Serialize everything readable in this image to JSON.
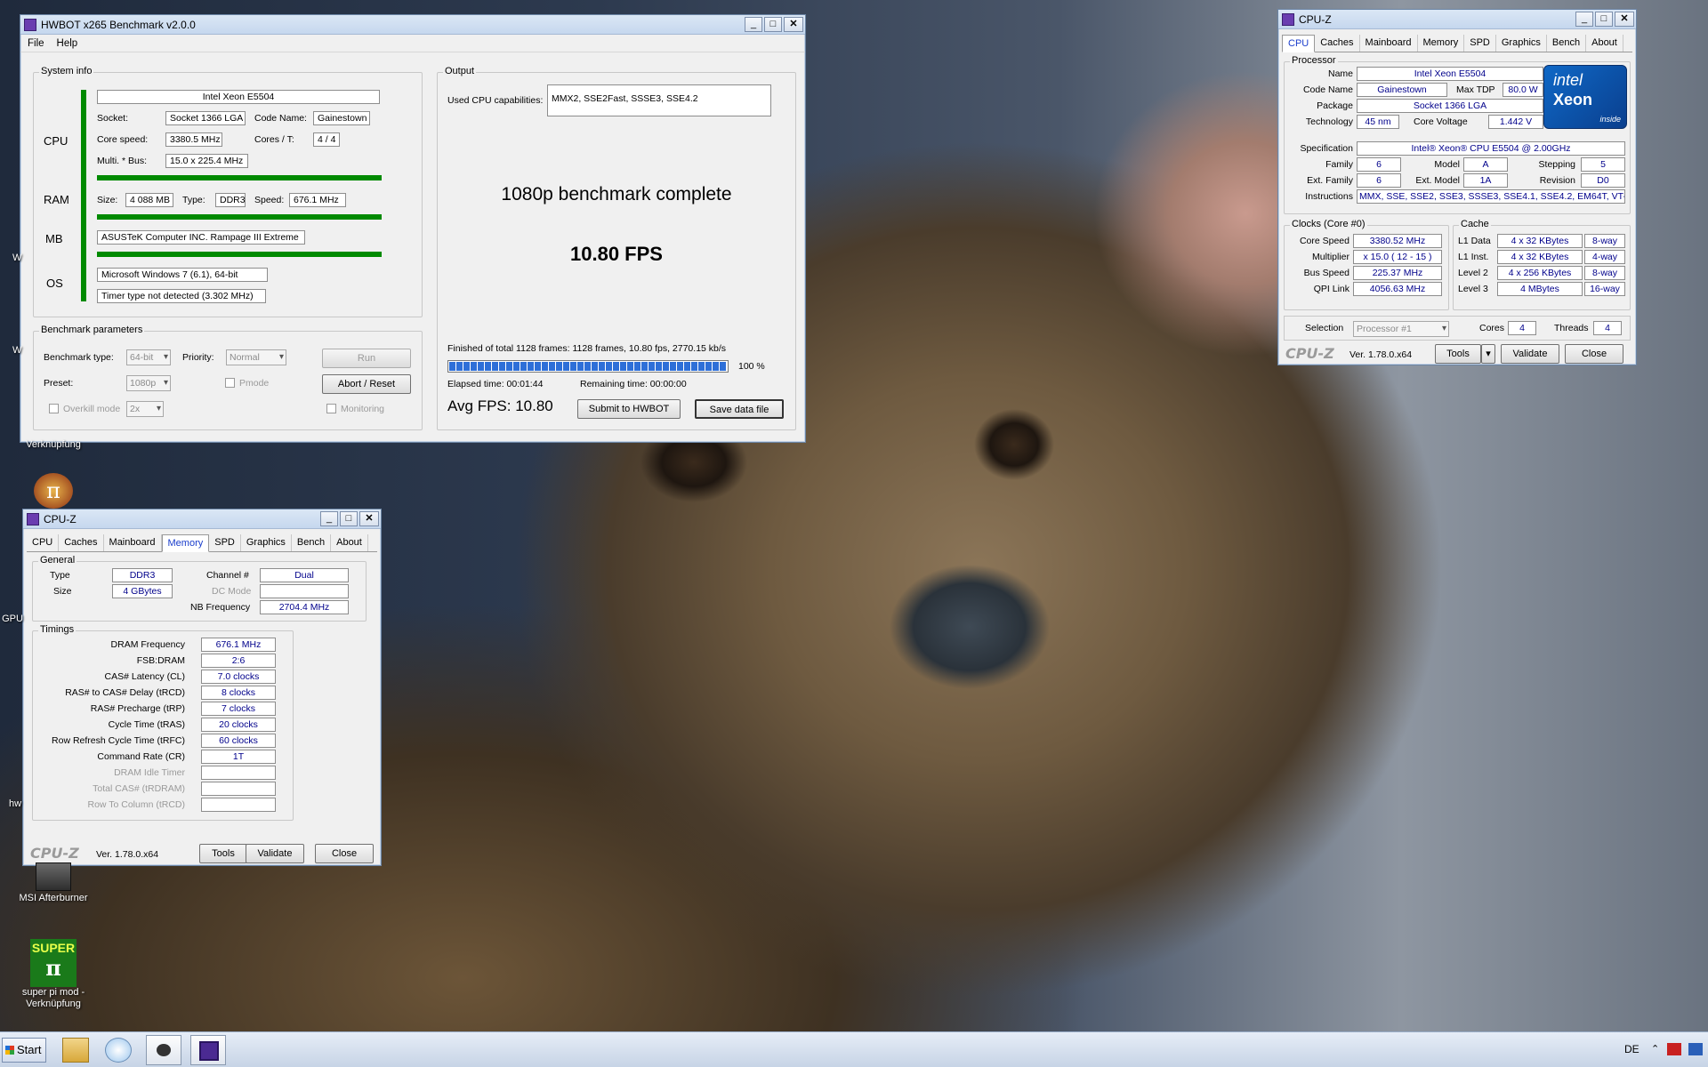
{
  "hwbot": {
    "title": "HWBOT x265 Benchmark v2.0.0",
    "menu": [
      "File",
      "Help"
    ],
    "sysinfo": {
      "group_title": "System info",
      "cpu_label": "CPU",
      "ram_label": "RAM",
      "mb_label": "MB",
      "os_label": "OS",
      "cpu_name": "Intel Xeon E5504",
      "socket_label": "Socket:",
      "socket": "Socket 1366 LGA",
      "codename_label": "Code Name:",
      "codename": "Gainestown",
      "corespeed_label": "Core speed:",
      "corespeed": "3380.5 MHz",
      "cores_label": "Cores / T:",
      "cores": "4 / 4",
      "multi_label": "Multi. * Bus:",
      "multi": "15.0 x 225.4 MHz",
      "size_label": "Size:",
      "size": "4 088 MB",
      "type_label": "Type:",
      "type": "DDR3",
      "speed_label": "Speed:",
      "speed": "676.1 MHz",
      "mb": "ASUSTeK Computer INC. Rampage III Extreme",
      "os": "Microsoft Windows 7 (6.1), 64-bit",
      "timer": "Timer type not detected (3.302 MHz)"
    },
    "params": {
      "group_title": "Benchmark parameters",
      "bench_type_label": "Benchmark type:",
      "bench_type": "64-bit",
      "priority_label": "Priority:",
      "priority": "Normal",
      "run_label": "Run",
      "preset_label": "Preset:",
      "preset": "1080p",
      "pmode_label": "Pmode",
      "abort_label": "Abort / Reset",
      "overkill_label": "Overkill mode",
      "overkill": "2x",
      "monitoring_label": "Monitoring"
    },
    "output": {
      "group_title": "Output",
      "caps_label": "Used CPU capabilities:",
      "caps": "MMX2, SSE2Fast, SSSE3, SSE4.2",
      "status": "1080p benchmark complete",
      "fps": "10.80 FPS",
      "finished": "Finished of total 1128 frames: 1128 frames, 10.80 fps,  2770.15 kb/s",
      "progress_pct": 100,
      "progress_text": "100 %",
      "elapsed": "Elapsed time: 00:01:44",
      "remaining": "Remaining time: 00:00:00",
      "avg": "Avg FPS: 10.80",
      "submit_label": "Submit to HWBOT",
      "save_label": "Save data file"
    }
  },
  "cpuz_cpu": {
    "title": "CPU-Z",
    "tabs": [
      "CPU",
      "Caches",
      "Mainboard",
      "Memory",
      "SPD",
      "Graphics",
      "Bench",
      "About"
    ],
    "processor_title": "Processor",
    "name_label": "Name",
    "name": "Intel Xeon E5504",
    "codename_label": "Code Name",
    "codename": "Gainestown",
    "maxtdp_label": "Max TDP",
    "maxtdp": "80.0 W",
    "package_label": "Package",
    "package": "Socket 1366 LGA",
    "tech_label": "Technology",
    "tech": "45 nm",
    "voltage_label": "Core Voltage",
    "voltage": "1.442 V",
    "spec_label": "Specification",
    "spec": "Intel® Xeon® CPU           E5504  @ 2.00GHz",
    "family_label": "Family",
    "family": "6",
    "model_label": "Model",
    "model": "A",
    "stepping_label": "Stepping",
    "stepping": "5",
    "extfamily_label": "Ext. Family",
    "extfamily": "6",
    "extmodel_label": "Ext. Model",
    "extmodel": "1A",
    "revision_label": "Revision",
    "revision": "D0",
    "instr_label": "Instructions",
    "instr": "MMX, SSE, SSE2, SSE3, SSSE3, SSE4.1, SSE4.2, EM64T, VT-x",
    "logo_brand": "intel",
    "logo_product": "Xeon",
    "logo_tag": "inside",
    "clocks_title": "Clocks (Core #0)",
    "corespeed_label": "Core Speed",
    "corespeed": "3380.52 MHz",
    "multiplier_label": "Multiplier",
    "multiplier": "x 15.0 ( 12 - 15 )",
    "busspeed_label": "Bus Speed",
    "busspeed": "225.37 MHz",
    "qpi_label": "QPI Link",
    "qpi": "4056.63 MHz",
    "cache_title": "Cache",
    "l1d_label": "L1 Data",
    "l1d": "4 x 32 KBytes",
    "l1d_way": "8-way",
    "l1i_label": "L1 Inst.",
    "l1i": "4 x 32 KBytes",
    "l1i_way": "4-way",
    "l2_label": "Level 2",
    "l2": "4 x 256 KBytes",
    "l2_way": "8-way",
    "l3_label": "Level 3",
    "l3": "4 MBytes",
    "l3_way": "16-way",
    "selection_label": "Selection",
    "selection": "Processor #1",
    "cores_label": "Cores",
    "cores": "4",
    "threads_label": "Threads",
    "threads": "4",
    "brand": "CPU-Z",
    "version": "Ver. 1.78.0.x64",
    "tools_label": "Tools",
    "validate_label": "Validate",
    "close_label": "Close"
  },
  "cpuz_mem": {
    "title": "CPU-Z",
    "tabs": [
      "CPU",
      "Caches",
      "Mainboard",
      "Memory",
      "SPD",
      "Graphics",
      "Bench",
      "About"
    ],
    "general_title": "General",
    "type_label": "Type",
    "type": "DDR3",
    "size_label": "Size",
    "size": "4 GBytes",
    "channel_label": "Channel #",
    "channel": "Dual",
    "dcmode_label": "DC Mode",
    "nbfreq_label": "NB Frequency",
    "nbfreq": "2704.4 MHz",
    "timings_title": "Timings",
    "rows": [
      {
        "label": "DRAM Frequency",
        "value": "676.1 MHz"
      },
      {
        "label": "FSB:DRAM",
        "value": "2:6"
      },
      {
        "label": "CAS# Latency (CL)",
        "value": "7.0 clocks"
      },
      {
        "label": "RAS# to CAS# Delay (tRCD)",
        "value": "8 clocks"
      },
      {
        "label": "RAS# Precharge (tRP)",
        "value": "7 clocks"
      },
      {
        "label": "Cycle Time (tRAS)",
        "value": "20 clocks"
      },
      {
        "label": "Row Refresh Cycle Time (tRFC)",
        "value": "60 clocks"
      },
      {
        "label": "Command Rate (CR)",
        "value": "1T"
      }
    ],
    "dis_rows": [
      "DRAM Idle Timer",
      "Total CAS# (tRDRAM)",
      "Row To Column (tRCD)"
    ],
    "brand": "CPU-Z",
    "version": "Ver. 1.78.0.x64",
    "tools_label": "Tools",
    "validate_label": "Validate",
    "close_label": "Close"
  },
  "desktop": {
    "icons": [
      "Verknüpfung",
      "MSI Afterburner",
      "super pi mod - Verknüpfung"
    ],
    "edge_texts": [
      "W",
      "W",
      "GPU",
      "hw"
    ]
  },
  "taskbar": {
    "start": "Start",
    "lang": "DE"
  }
}
